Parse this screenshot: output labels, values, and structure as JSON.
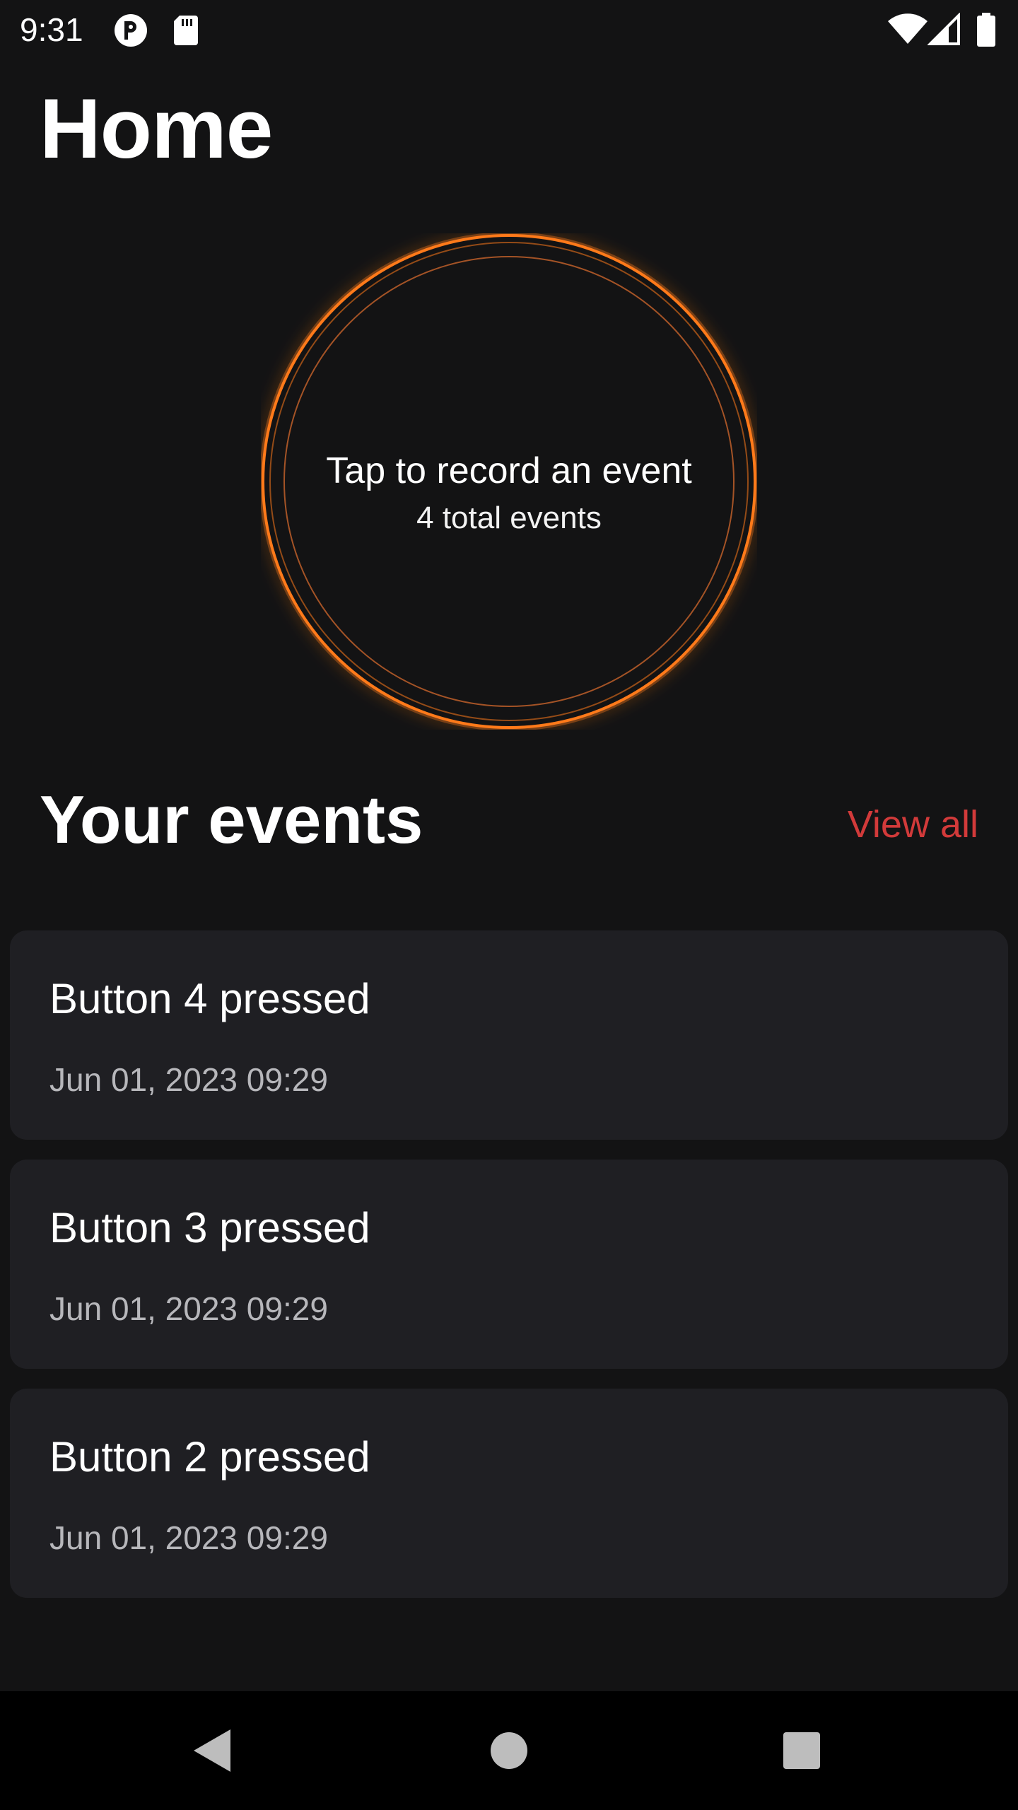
{
  "status_bar": {
    "time": "9:31",
    "left_icons": [
      "app-notification-icon",
      "sd-card-icon"
    ],
    "right_icons": [
      "wifi-icon",
      "cell-signal-icon",
      "battery-icon"
    ]
  },
  "page": {
    "title": "Home"
  },
  "record_button": {
    "label": "Tap to record an event",
    "count_text": "4 total events",
    "accent_color": "#ff7a1a"
  },
  "events_section": {
    "title": "Your events",
    "view_all_label": "View all",
    "link_color": "#d23a3a",
    "items": [
      {
        "name": "Button 4 pressed",
        "date": "Jun 01, 2023 09:29"
      },
      {
        "name": "Button 3 pressed",
        "date": "Jun 01, 2023 09:29"
      },
      {
        "name": "Button 2 pressed",
        "date": "Jun 01, 2023 09:29"
      }
    ]
  },
  "nav_bar": {
    "buttons": [
      "back-icon",
      "home-icon",
      "recents-icon"
    ]
  }
}
